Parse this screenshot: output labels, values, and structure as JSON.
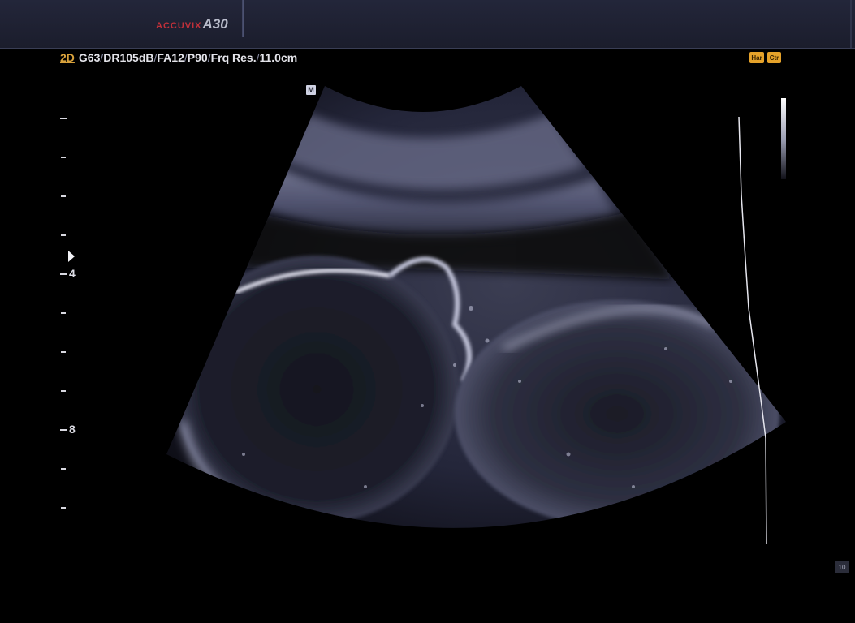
{
  "header": {
    "brand_name": "ACCUVIX",
    "brand_model": "A30"
  },
  "imaging": {
    "mode": "2D",
    "parameters": [
      {
        "label": "G63"
      },
      {
        "label": "DR105dB"
      },
      {
        "label": "FA12"
      },
      {
        "label": "P90"
      },
      {
        "label": "Frq Res."
      },
      {
        "label": "11.0cm"
      }
    ]
  },
  "badges": {
    "harmonic": "Har",
    "compound": "Ctr"
  },
  "orientation_marker": "M",
  "depth_scale": {
    "labels": [
      "4",
      "8"
    ]
  },
  "frame_indicator": "10",
  "colors": {
    "accent": "#e5a22a",
    "brand_red": "#c0303a",
    "mode_label": "#d9a23c"
  },
  "icons": {
    "focus": "focus-marker-icon",
    "tgc": "tgc-curve-icon",
    "graybar": "grayscale-bar-icon"
  }
}
